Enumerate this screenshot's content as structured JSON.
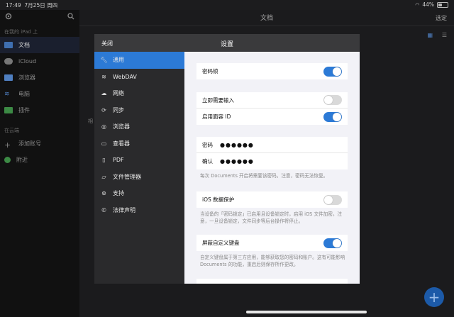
{
  "status": {
    "time": "17:49",
    "date": "7月25日 周四",
    "battery": "44%",
    "battery_level": 0.44
  },
  "sidebar": {
    "section_device": "在我的 iPad 上",
    "items": [
      {
        "label": "文档",
        "active": true
      },
      {
        "label": "iCloud"
      },
      {
        "label": "浏览器"
      },
      {
        "label": "电脑"
      },
      {
        "label": "插件"
      }
    ],
    "section_cloud": "在云端",
    "cloud_items": [
      {
        "label": "添加账号"
      },
      {
        "label": "附近"
      }
    ]
  },
  "main": {
    "title": "文档",
    "select_label": "选定",
    "hidden_char": "相"
  },
  "modal": {
    "close_label": "关闭",
    "title": "设置",
    "menu": [
      {
        "label": "通用",
        "icon": "wrench-icon",
        "active": true
      },
      {
        "label": "WebDAV",
        "icon": "wifi-icon"
      },
      {
        "label": "网络",
        "icon": "cloud-icon"
      },
      {
        "label": "同步",
        "icon": "sync-icon"
      },
      {
        "label": "浏览器",
        "icon": "compass-icon"
      },
      {
        "label": "查看器",
        "icon": "viewer-icon"
      },
      {
        "label": "PDF",
        "icon": "document-icon"
      },
      {
        "label": "文件管理器",
        "icon": "folder-icon"
      },
      {
        "label": "支持",
        "icon": "lifebuoy-icon"
      },
      {
        "label": "法律声明",
        "icon": "copyright-icon"
      }
    ],
    "settings": {
      "passcode_lock": {
        "label": "密码锁",
        "on": true
      },
      "require_immediately": {
        "label": "立即需要输入",
        "on": false
      },
      "face_id": {
        "label": "启用面容 ID",
        "on": true
      },
      "password": {
        "label": "密码",
        "value": "●●●●●●"
      },
      "confirm": {
        "label": "确认",
        "value": "●●●●●●"
      },
      "password_note": "每次 Documents 开启将需要该密码。注意，密码无法恢复。",
      "ios_protection": {
        "label": "iOS 数据保护",
        "on": false
      },
      "ios_note": "当设备的「密码锁定」已启用且设备锁定时，启用 iOS 文件加密。注意，一旦设备锁定，文件同步等后台操作将停止。",
      "block_keyboards": {
        "label": "屏蔽自定义键盘",
        "on": true
      },
      "keyboard_note": "自定义键盘属于第三方应用，能够获取您的密码和账户。这有可能影响 Documents 的功能，重启后则保存所作更改。"
    }
  }
}
